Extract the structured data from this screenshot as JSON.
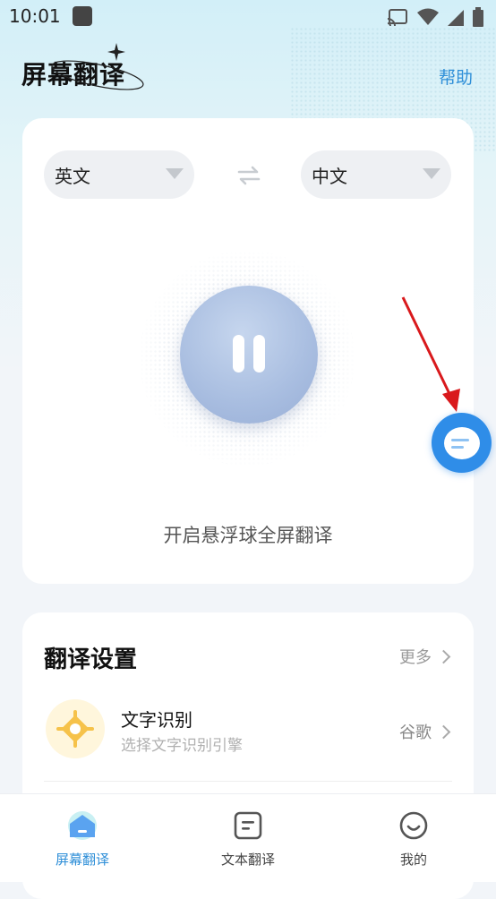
{
  "status_bar": {
    "time": "10:01"
  },
  "header": {
    "title": "屏幕翻译",
    "help": "帮助"
  },
  "translate_card": {
    "source_lang": "英文",
    "target_lang": "中文",
    "caption": "开启悬浮球全屏翻译"
  },
  "settings": {
    "title": "翻译设置",
    "more": "更多",
    "rows": [
      {
        "title": "文字识别",
        "subtitle": "选择文字识别引擎",
        "value": "谷歌"
      }
    ]
  },
  "bottom_nav": {
    "items": [
      {
        "label": "屏幕翻译",
        "icon": "home-icon",
        "active": true
      },
      {
        "label": "文本翻译",
        "icon": "document-icon",
        "active": false
      },
      {
        "label": "我的",
        "icon": "smile-icon",
        "active": false
      }
    ]
  },
  "colors": {
    "accent": "#2f8fd8",
    "float_ball": "#2f8de8",
    "play_button": "#a8bde0",
    "arrow": "#d9191c"
  }
}
